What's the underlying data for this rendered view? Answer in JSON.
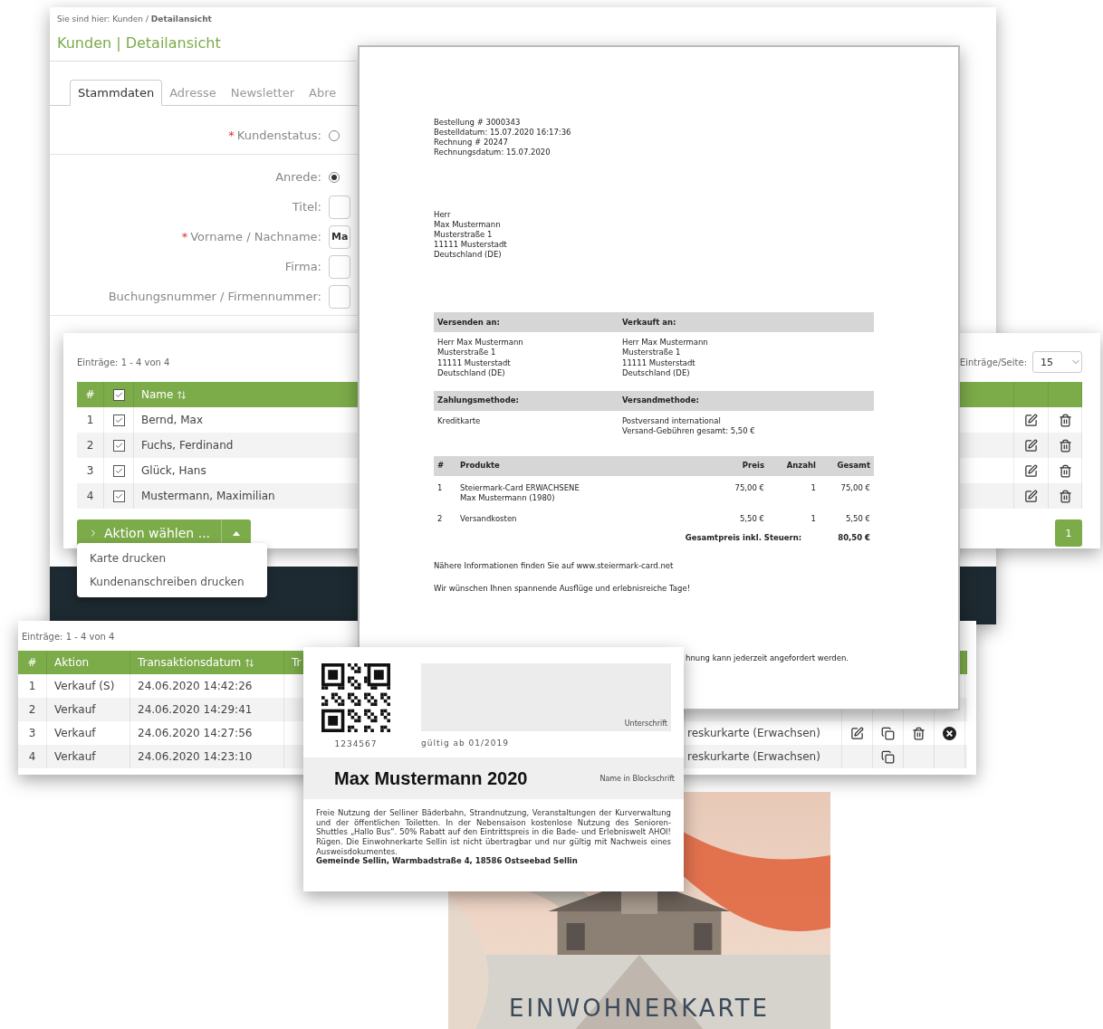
{
  "customer_window": {
    "breadcrumb": "Sie sind hier: Kunden / **Detailansicht**",
    "title": "Kunden | Detailansicht",
    "tabs": [
      {
        "label": "Stammdaten",
        "selected": true
      },
      {
        "label": "Adresse",
        "selected": false
      },
      {
        "label": "Newsletter",
        "selected": false
      },
      {
        "label": "Abre",
        "selected": false
      }
    ],
    "form": [
      {
        "kind": "radio",
        "required_mark": "*",
        "label": "Kundenstatus:",
        "checked": false,
        "divider": true
      },
      {
        "kind": "radio",
        "label": "Anrede:",
        "checked": true
      },
      {
        "kind": "input",
        "label": "Titel:"
      },
      {
        "kind": "input",
        "required_mark": "*",
        "label": "Vorname / Nachname:",
        "value": "Ma"
      },
      {
        "kind": "input",
        "label": "Firma:"
      },
      {
        "kind": "input",
        "label": "Buchungsnummer / Firmennummer:",
        "divider": true
      }
    ]
  },
  "customer_list": {
    "entries_info": "Einträge: 1 - 4 von 4",
    "per_page_label": "Einträge/Seite:",
    "per_page_value": "15",
    "header_checked": true,
    "columns": [
      "#",
      "Name"
    ],
    "rows": [
      {
        "number": "1",
        "name": "Bernd, Max",
        "checked": true
      },
      {
        "number": "2",
        "name": "Fuchs, Ferdinand",
        "checked": true
      },
      {
        "number": "3",
        "name": "Glück, Hans",
        "checked": true
      },
      {
        "number": "4",
        "name": "Mustermann, Maximilian",
        "checked": true
      }
    ],
    "action_button": "Aktion wählen ...",
    "pages": [
      {
        "label": "1",
        "selected": true
      }
    ]
  },
  "action_menu": {
    "items": [
      "Karte drucken",
      "Kundenanschreiben drucken"
    ]
  },
  "invoice": {
    "order_info": [
      "Bestellung # 3000343",
      "Bestelldatum: 15.07.2020 16:17:36",
      "Rechnung # 20247",
      "Rechnungsdatum: 15.07.2020"
    ],
    "recipient": [
      "Herr",
      "Max Mustermann",
      "Musterstraße 1",
      "11111 Musterstadt",
      "Deutschland (DE)"
    ],
    "sections": [
      {
        "headings": [
          "Versenden an:",
          "Verkauft an:"
        ],
        "columns": [
          [
            "Herr Max Mustermann",
            "Musterstraße 1",
            "11111 Musterstadt",
            "Deutschland (DE)"
          ],
          [
            "Herr Max Mustermann",
            "Musterstraße 1",
            "11111 Musterstadt",
            "Deutschland (DE)"
          ]
        ]
      },
      {
        "headings": [
          "Zahlungsmethode:",
          "Versandmethode:"
        ],
        "columns": [
          [
            "Kreditkarte"
          ],
          [
            "Postversand international",
            "Versand-Gebühren gesamt: 5,50 €"
          ]
        ]
      }
    ],
    "product_columns": [
      "#",
      "Produkte",
      "Preis",
      "Anzahl",
      "Gesamt"
    ],
    "products": [
      {
        "number": "1",
        "lines": [
          "Steiermark-Card ERWACHSENE",
          "Max Mustermann (1980)"
        ],
        "price": "75,00 €",
        "quantity": "1",
        "total": "75,00 €"
      },
      {
        "number": "2",
        "lines": [
          "Versandkosten"
        ],
        "price": "5,50 €",
        "quantity": "1",
        "total": "5,50 €"
      }
    ],
    "total_label": "Gesamtpreis inkl. Steuern:",
    "total": "80,50 €",
    "notes": [
      "Nähere Informationen finden Sie auf www.steiermark-card.net",
      "Wir wünschen Ihnen spannende Ausflüge und erlebnisreiche Tage!"
    ],
    "footer_line": "hnung kann jederzeit angefordert werden."
  },
  "transactions": {
    "entries_info": "Einträge: 1 - 4 von 4",
    "columns": [
      "#",
      "Aktion",
      "Transaktionsdatum",
      "Tr"
    ],
    "rows": [
      {
        "number": "1",
        "action": "Verkauf (S)",
        "date": "24.06.2020 14:42:26"
      },
      {
        "number": "2",
        "action": "Verkauf",
        "date": "24.06.2020 14:29:41"
      },
      {
        "number": "3",
        "action": "Verkauf",
        "date": "24.06.2020 14:27:56",
        "product": "reskurkarte (Erwachsen)",
        "buttons": [
          {
            "kind": "edit"
          },
          {
            "kind": "copy"
          },
          {
            "kind": "delete"
          },
          {
            "kind": "cancel"
          }
        ]
      },
      {
        "number": "4",
        "action": "Verkauf",
        "date": "24.06.2020 14:23:10",
        "product": "reskurkarte (Erwachsen)",
        "buttons": [
          {
            "kind": "copy"
          }
        ]
      }
    ]
  },
  "card": {
    "number": "1234567",
    "signature_label": "Unterschrift",
    "valid_from": "gültig ab 01/2019",
    "name": "Max Mustermann 2020",
    "name_label": "Name in Blockschrift",
    "description": "Freie Nutzung der Selliner Bäderbahn, Strandnutzung, Veranstaltungen der Kurverwaltung und der öffentlichen Toiletten. In der Nebensaison kostenlose Nutzung des Senioren-Shuttles „Hallo Bus“. 50% Rabatt auf den Eintrittspreis in die Bade- und Erlebniswelt AHOI! Rügen. Die Einwohnerkarte Sellin ist nicht übertragbar und nur gültig mit Nachweis eines Ausweisdokumentes.",
    "address": "Gemeinde Sellin, Warmbadstraße 4, 18586 Ostseebad Sellin"
  },
  "card_picture": {
    "kind": "picture",
    "title": "EINWOHNERKARTE"
  }
}
